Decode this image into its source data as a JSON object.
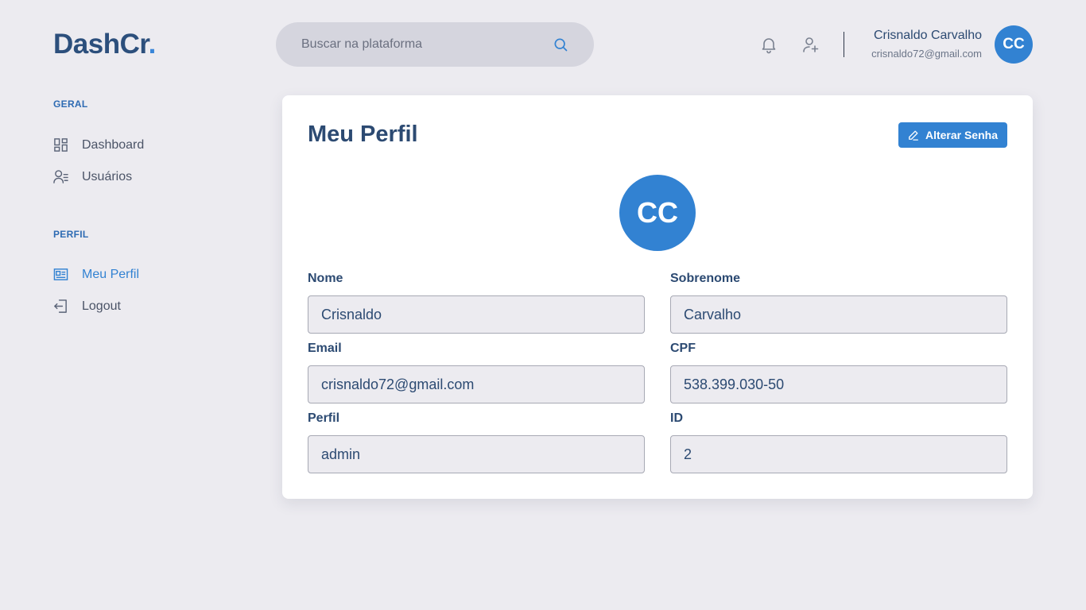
{
  "brand": {
    "name": "DashCr",
    "dot": "."
  },
  "search": {
    "placeholder": "Buscar na plataforma"
  },
  "header": {
    "user_name": "Crisnaldo Carvalho",
    "user_email": "crisnaldo72@gmail.com",
    "user_initials": "CC"
  },
  "sidebar": {
    "sections": [
      {
        "label": "GERAL",
        "items": [
          {
            "label": "Dashboard",
            "icon": "dashboard-icon"
          },
          {
            "label": "Usuários",
            "icon": "users-icon"
          }
        ]
      },
      {
        "label": "PERFIL",
        "items": [
          {
            "label": "Meu Perfil",
            "icon": "profile-card-icon"
          },
          {
            "label": "Logout",
            "icon": "logout-icon"
          }
        ]
      }
    ]
  },
  "profile": {
    "title": "Meu Perfil",
    "change_password_label": "Alterar Senha",
    "initials": "CC",
    "fields": [
      {
        "label": "Nome",
        "value": "Crisnaldo"
      },
      {
        "label": "Sobrenome",
        "value": "Carvalho"
      },
      {
        "label": "Email",
        "value": "crisnaldo72@gmail.com"
      },
      {
        "label": "CPF",
        "value": "538.399.030-50"
      },
      {
        "label": "Perfil",
        "value": "admin"
      },
      {
        "label": "ID",
        "value": "2"
      }
    ]
  },
  "colors": {
    "accent": "#3282d2",
    "background": "#ecebf0",
    "text": "#2c4a72"
  }
}
